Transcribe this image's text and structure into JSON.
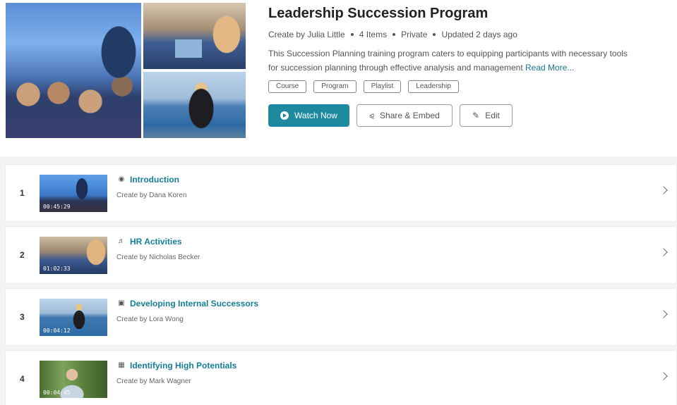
{
  "header": {
    "title": "Leadership Succession Program",
    "meta": {
      "creator": "Create by Julia Little",
      "items": "4 Items",
      "privacy": "Private",
      "updated": "Updated 2 days ago"
    },
    "description": "This Succession Planning training program caters to equipping participants with necessary tools for succession planning through effective analysis and management",
    "read_more": "Read More...",
    "tags": [
      "Course",
      "Program",
      "Playlist",
      "Leadership"
    ],
    "actions": {
      "watch_now": "Watch Now",
      "share_embed": "Share & Embed",
      "edit": "Edit"
    }
  },
  "playlist": [
    {
      "number": "1",
      "type_icon": "globe-icon",
      "title": "Introduction",
      "creator": "Create by Dana Koren",
      "duration": "00:45:29"
    },
    {
      "number": "2",
      "type_icon": "audio-icon",
      "title": "HR Activities",
      "creator": "Create by Nicholas Becker",
      "duration": "01:02:33"
    },
    {
      "number": "3",
      "type_icon": "image-icon",
      "title": "Developing Internal Successors",
      "creator": "Create by Lora Wong",
      "duration": "00:04:12"
    },
    {
      "number": "4",
      "type_icon": "video-icon",
      "title": "Identifying High Potentials",
      "creator": "Create by Mark Wagner",
      "duration": "00:04:45"
    }
  ],
  "colors": {
    "accent": "#1e8aa0",
    "link": "#157f98",
    "background": "#f4f4f4"
  }
}
